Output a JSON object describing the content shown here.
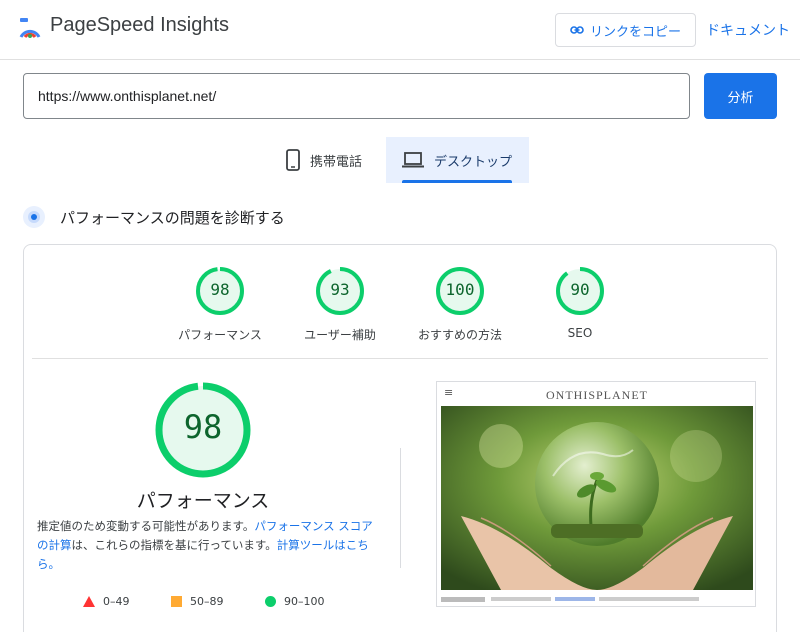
{
  "header": {
    "brand": "PageSpeed Insights",
    "copy_link_label": "リンクをコピー",
    "docs_label": "ドキュメント"
  },
  "search": {
    "url": "https://www.onthisplanet.net/",
    "analyze_label": "分析"
  },
  "tabs": [
    {
      "label": "携帯電話",
      "icon": "phone-icon",
      "selected": false
    },
    {
      "label": "デスクトップ",
      "icon": "laptop-icon",
      "selected": true
    }
  ],
  "section": {
    "title": "パフォーマンスの問題を診断する"
  },
  "scores": [
    {
      "label": "パフォーマンス",
      "value": "98",
      "fraction": 0.98
    },
    {
      "label": "ユーザー補助",
      "value": "93",
      "fraction": 0.93
    },
    {
      "label": "おすすめの方法",
      "value": "100",
      "fraction": 1.0
    },
    {
      "label": "SEO",
      "value": "90",
      "fraction": 0.9
    }
  ],
  "performance": {
    "value": "98",
    "fraction": 0.98,
    "title": "パフォーマンス",
    "note_prefix": "推定値のため変動する可能性があります。",
    "note_link1": "パフォーマンス スコアの計算",
    "note_mid": "は、これらの指標を基に行っています。",
    "note_link2": "計算ツールはこちら。"
  },
  "legend": [
    {
      "range": "0–49",
      "shape": "triangle",
      "color": "#ff3333"
    },
    {
      "range": "50–89",
      "shape": "square",
      "color": "#ffaa33"
    },
    {
      "range": "90–100",
      "shape": "circle",
      "color": "#0cce6b"
    }
  ],
  "preview": {
    "site_title": "ONTHISPLANET"
  },
  "colors": {
    "accent": "#1a73e8",
    "pass": "#0cce6b",
    "pass_text": "#0d652d",
    "pass_fill": "#e6f9ee"
  }
}
